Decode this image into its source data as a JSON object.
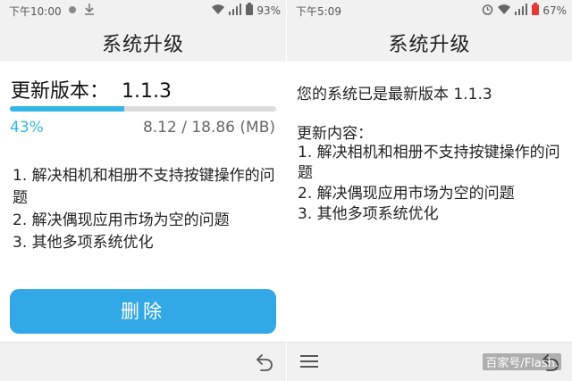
{
  "left_screen": {
    "status": {
      "time": "下午10:00",
      "battery": "93%"
    },
    "title": "系统升级",
    "version_label": "更新版本：",
    "version_value": "1.1.3",
    "progress": {
      "percent": 43,
      "percent_label": "43%",
      "size_label": "8.12 / 18.86 (MB)"
    },
    "changelog": [
      "1. 解决相机和相册不支持按键操作的问题",
      "2. 解决偶现应用市场为空的问题",
      "3. 其他多项系统优化"
    ],
    "delete_button": "删除",
    "icons": [
      "signal-icon",
      "download-icon",
      "wifi-icon",
      "cell-signal-icon",
      "battery-icon",
      "back-icon"
    ]
  },
  "right_screen": {
    "status": {
      "time": "下午5:09",
      "battery": "67%"
    },
    "title": "系统升级",
    "latest_text": "您的系统已是最新版本 1.1.3",
    "changes_title": "更新内容：",
    "changelog": [
      "1. 解决相机和相册不支持按键操作的问题",
      "2. 解决偶现应用市场为空的问题",
      "3. 其他多项系统优化"
    ],
    "icons": [
      "alarm-icon",
      "wifi-icon",
      "cell-signal-icon",
      "battery-icon",
      "menu-icon",
      "back-icon"
    ]
  },
  "watermark": "百家号/Flash.",
  "colors": {
    "accent": "#33b5e5",
    "button": "#33a8e7",
    "background": "#f1f1f1",
    "battery_low": "#e53935"
  }
}
